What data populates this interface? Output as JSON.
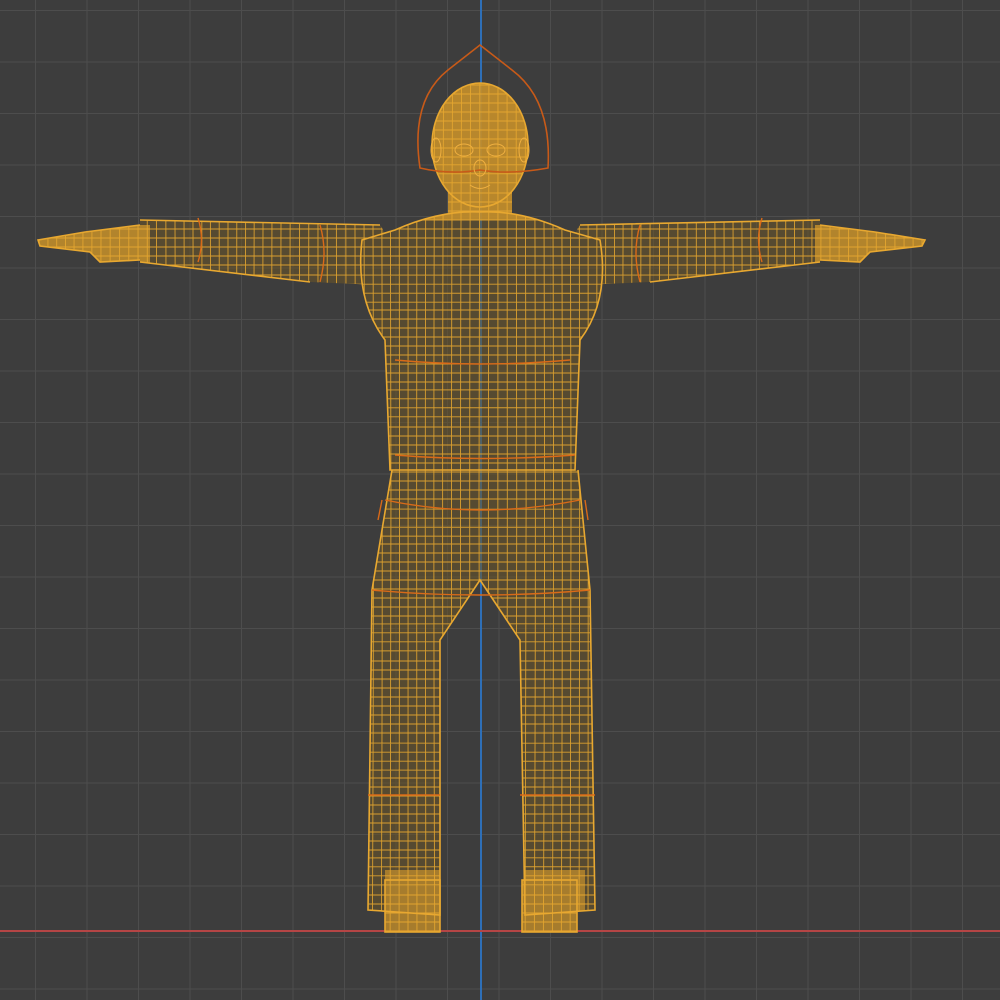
{
  "viewport": {
    "grid_color": "#4d4d4d",
    "background_color": "#3d3d3d",
    "axis_z_color": "#2e6fb7",
    "axis_x_color": "#b54545"
  },
  "object": {
    "wire_color": "#e8a830",
    "fill_color": "#b8852a",
    "outline_color": "#d96a18",
    "head_bone_color": "#c85a18",
    "pose": "t-pose"
  }
}
